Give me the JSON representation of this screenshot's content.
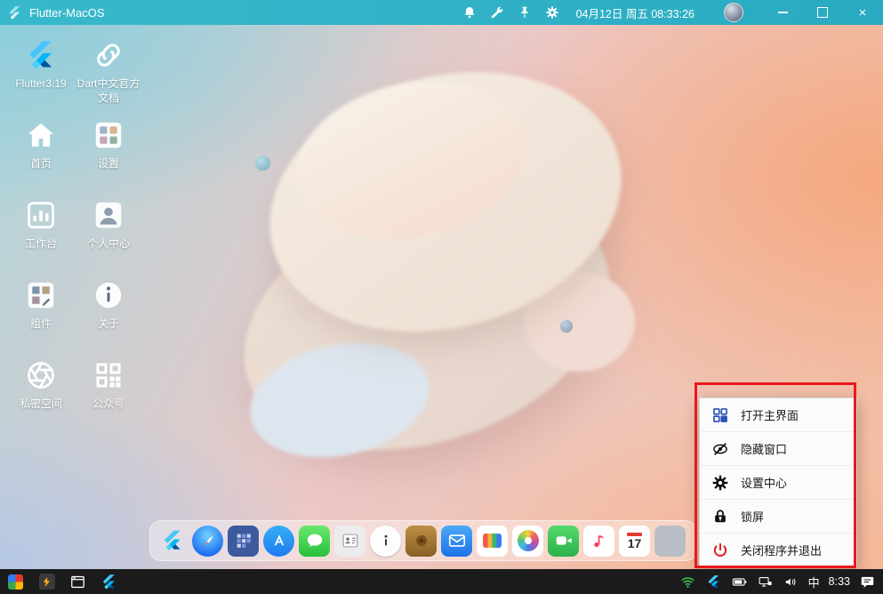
{
  "titlebar": {
    "title": "Flutter-MacOS",
    "datetime": "04月12日 周五 08:33:26",
    "icons": [
      "bell",
      "tools",
      "pin",
      "gear"
    ],
    "window_controls": [
      "minimize",
      "maximize",
      "close"
    ]
  },
  "desktop": {
    "icons": [
      {
        "label": "Flutter3.19",
        "icon": "flutter-logo"
      },
      {
        "label": "Dart中文官方文档",
        "icon": "link"
      },
      {
        "label": "首页",
        "icon": "home"
      },
      {
        "label": "设置",
        "icon": "settings-panel"
      },
      {
        "label": "工作台",
        "icon": "bar-chart"
      },
      {
        "label": "个人中心",
        "icon": "person-panel"
      },
      {
        "label": "组件",
        "icon": "components-panel"
      },
      {
        "label": "关于",
        "icon": "info-circle"
      },
      {
        "label": "私密空间",
        "icon": "aperture"
      },
      {
        "label": "公众号",
        "icon": "qr-code"
      }
    ]
  },
  "dock": {
    "icons": [
      "flutter",
      "safari",
      "pixel-grid",
      "app-store",
      "messages",
      "contacts",
      "info",
      "nut",
      "mail",
      "stats",
      "photos",
      "facetime",
      "music",
      "calendar",
      "hidden-app"
    ],
    "calendar_day": "17"
  },
  "context_menu": {
    "items": [
      {
        "label": "打开主界面",
        "icon": "grid"
      },
      {
        "label": "隐藏窗口",
        "icon": "eye-off"
      },
      {
        "label": "设置中心",
        "icon": "gear"
      },
      {
        "label": "锁屏",
        "icon": "lock"
      },
      {
        "label": "关闭程序并退出",
        "icon": "power",
        "color": "#e02222"
      }
    ]
  },
  "taskbar": {
    "left_icons": [
      "colorful-app",
      "lightning-app",
      "window-app",
      "flutter"
    ],
    "tray_icons": [
      "wifi",
      "flutter",
      "battery",
      "ethernet",
      "volume",
      "notification"
    ],
    "ime": "中",
    "time": "8:33"
  },
  "annotation": {
    "color": "#e8191f"
  }
}
